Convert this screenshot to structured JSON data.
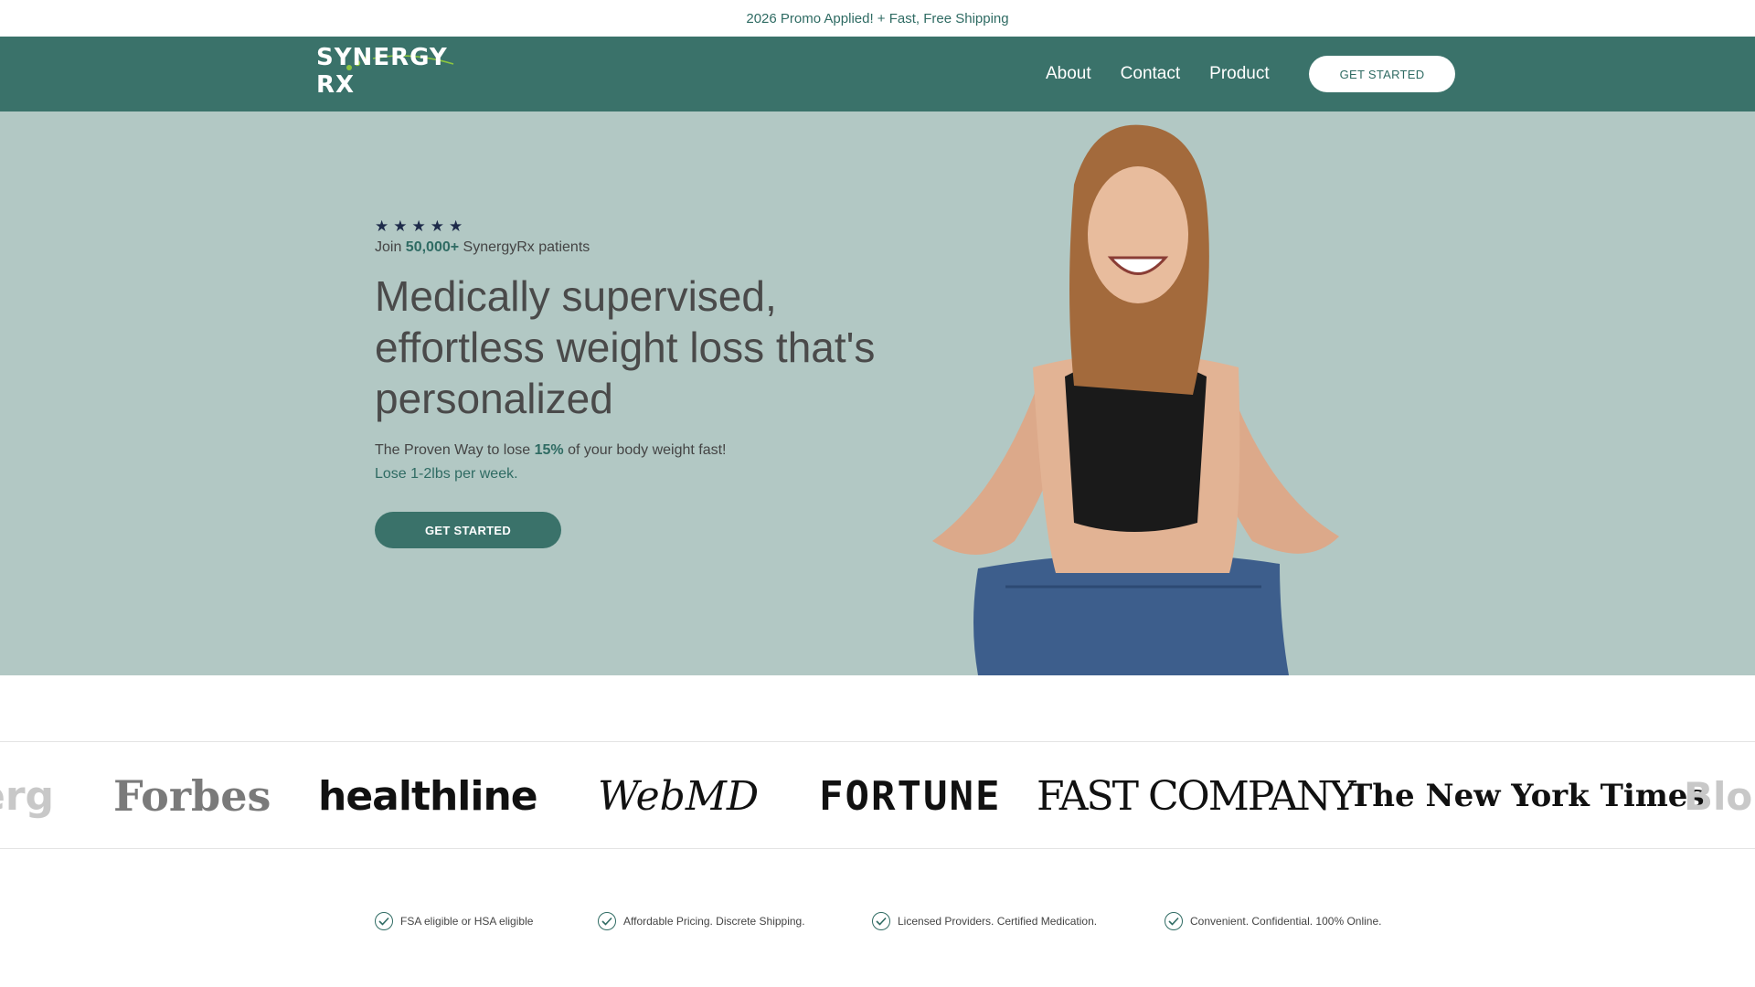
{
  "promo": {
    "text": "2026 Promo Applied! + Fast, Free Shipping"
  },
  "nav": {
    "logo_text": "SYNERGY RX",
    "links": [
      "About",
      "Contact",
      "Product"
    ],
    "cta_label": "GET STARTED"
  },
  "hero": {
    "rating_stars": 5,
    "social_proof": {
      "prefix": "Join ",
      "count": "50,000+",
      "suffix": " SynergyRx patients"
    },
    "headline_lines": [
      "Medically supervised,",
      "effortless weight loss that's",
      "personalized"
    ],
    "subline": {
      "prefix": "The Proven Way to lose ",
      "highlight": "15%",
      "suffix": " of your body weight fast!"
    },
    "subline2": "Lose 1-2lbs per week.",
    "cta_label": "GET STARTED"
  },
  "press_logos": {
    "bloomberg_left": "erg",
    "forbes": "Forbes",
    "healthline": "healthline",
    "webmd": "WebMD",
    "fortune": "FORTUNE",
    "fastco": "FAST COMPANY",
    "nyt": "The New York Times",
    "bloomberg_right": "Blo"
  },
  "features": [
    "FSA eligible or HSA eligible",
    "Affordable Pricing. Discrete Shipping.",
    "Licensed Providers. Certified Medication.",
    "Convenient. Confidential. 100% Online."
  ],
  "colors": {
    "brand": "#3a726a",
    "hero_bg": "#b2c8c4",
    "accent_green": "#8cc63f",
    "star": "#1e2b4a"
  }
}
